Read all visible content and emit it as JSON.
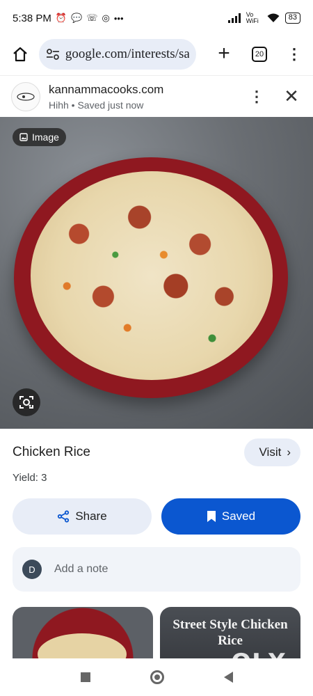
{
  "status_bar": {
    "time": "5:38 PM",
    "left_icons": [
      "alarm-icon",
      "chat-bubble-icon",
      "phone-missed-icon",
      "whatsapp-icon",
      "more-dots-icon"
    ],
    "volte": "Vo WiFi",
    "battery": "83"
  },
  "browser": {
    "url": "google.com/interests/sa",
    "tab_count": "20"
  },
  "panel": {
    "site_name": "kannammacooks.com",
    "subtitle": "Hihh • Saved just now"
  },
  "hero": {
    "chip_label": "Image"
  },
  "recipe": {
    "title": "Chicken Rice",
    "visit_label": "Visit",
    "yield_text": "Yield: 3"
  },
  "actions": {
    "share_label": "Share",
    "saved_label": "Saved"
  },
  "note": {
    "avatar_initial": "D",
    "placeholder": "Add a note"
  },
  "related": {
    "card_2_text": "Street Style Chicken Rice"
  },
  "watermark": "OLX",
  "colors": {
    "accent_blue": "#0b57d0",
    "chip_bg": "#e8edf7",
    "bowl_red": "#8f1820"
  }
}
